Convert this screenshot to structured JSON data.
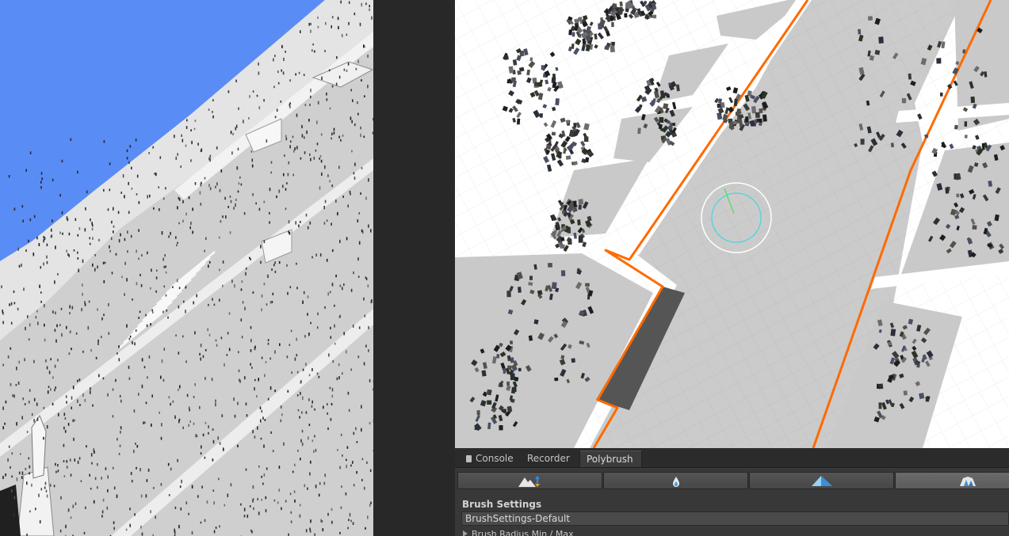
{
  "editor_panel": {
    "tabs": [
      {
        "label": "Console",
        "icon": "console-icon",
        "active": false
      },
      {
        "label": "Recorder",
        "active": false
      },
      {
        "label": "Polybrush",
        "active": true
      }
    ],
    "mode_buttons": [
      {
        "icon": "sculpt-mode-icon",
        "active": false
      },
      {
        "icon": "smooth-mode-icon",
        "active": false
      },
      {
        "icon": "paint-mode-icon",
        "active": false
      },
      {
        "icon": "prefab-mode-icon",
        "active": true
      }
    ],
    "brush_settings": {
      "title": "Brush Settings",
      "preset": "BrushSettings-Default",
      "radius_label": "Brush Radius Min / Max"
    }
  },
  "colors": {
    "sky": "#5a8cf5",
    "path_highlight": "#ff6a00",
    "brush_gizmo": "#40d8e0",
    "panel_bg": "#383838"
  }
}
